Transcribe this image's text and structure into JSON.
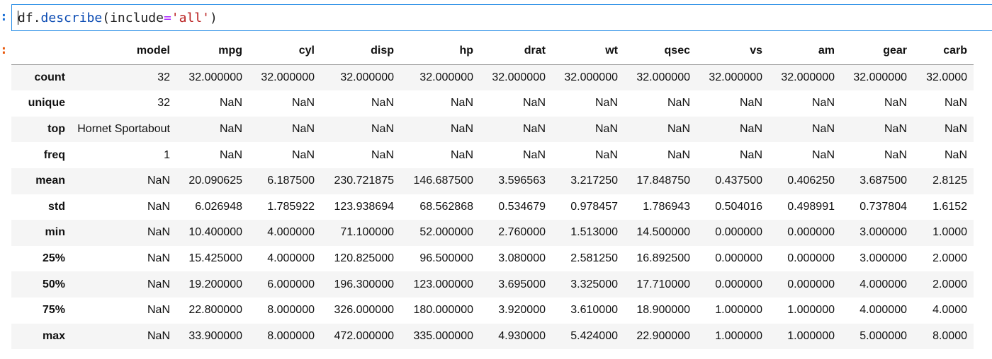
{
  "prompts": {
    "in_marker": ":",
    "out_marker": ":"
  },
  "code": {
    "obj": "df",
    "dot": ".",
    "method": "describe",
    "open": "(",
    "kw": "include",
    "eq": "=",
    "str": "'all'",
    "close": ")"
  },
  "table": {
    "columns": [
      "model",
      "mpg",
      "cyl",
      "disp",
      "hp",
      "drat",
      "wt",
      "qsec",
      "vs",
      "am",
      "gear",
      "carb"
    ],
    "rows": [
      {
        "label": "count",
        "values": [
          "32",
          "32.000000",
          "32.000000",
          "32.000000",
          "32.000000",
          "32.000000",
          "32.000000",
          "32.000000",
          "32.000000",
          "32.000000",
          "32.000000",
          "32.0000"
        ]
      },
      {
        "label": "unique",
        "values": [
          "32",
          "NaN",
          "NaN",
          "NaN",
          "NaN",
          "NaN",
          "NaN",
          "NaN",
          "NaN",
          "NaN",
          "NaN",
          "NaN"
        ]
      },
      {
        "label": "top",
        "values": [
          "Hornet Sportabout",
          "NaN",
          "NaN",
          "NaN",
          "NaN",
          "NaN",
          "NaN",
          "NaN",
          "NaN",
          "NaN",
          "NaN",
          "NaN"
        ]
      },
      {
        "label": "freq",
        "values": [
          "1",
          "NaN",
          "NaN",
          "NaN",
          "NaN",
          "NaN",
          "NaN",
          "NaN",
          "NaN",
          "NaN",
          "NaN",
          "NaN"
        ]
      },
      {
        "label": "mean",
        "values": [
          "NaN",
          "20.090625",
          "6.187500",
          "230.721875",
          "146.687500",
          "3.596563",
          "3.217250",
          "17.848750",
          "0.437500",
          "0.406250",
          "3.687500",
          "2.8125"
        ]
      },
      {
        "label": "std",
        "values": [
          "NaN",
          "6.026948",
          "1.785922",
          "123.938694",
          "68.562868",
          "0.534679",
          "0.978457",
          "1.786943",
          "0.504016",
          "0.498991",
          "0.737804",
          "1.6152"
        ]
      },
      {
        "label": "min",
        "values": [
          "NaN",
          "10.400000",
          "4.000000",
          "71.100000",
          "52.000000",
          "2.760000",
          "1.513000",
          "14.500000",
          "0.000000",
          "0.000000",
          "3.000000",
          "1.0000"
        ]
      },
      {
        "label": "25%",
        "values": [
          "NaN",
          "15.425000",
          "4.000000",
          "120.825000",
          "96.500000",
          "3.080000",
          "2.581250",
          "16.892500",
          "0.000000",
          "0.000000",
          "3.000000",
          "2.0000"
        ]
      },
      {
        "label": "50%",
        "values": [
          "NaN",
          "19.200000",
          "6.000000",
          "196.300000",
          "123.000000",
          "3.695000",
          "3.325000",
          "17.710000",
          "0.000000",
          "0.000000",
          "4.000000",
          "2.0000"
        ]
      },
      {
        "label": "75%",
        "values": [
          "NaN",
          "22.800000",
          "8.000000",
          "326.000000",
          "180.000000",
          "3.920000",
          "3.610000",
          "18.900000",
          "1.000000",
          "1.000000",
          "4.000000",
          "4.0000"
        ]
      },
      {
        "label": "max",
        "values": [
          "NaN",
          "33.900000",
          "8.000000",
          "472.000000",
          "335.000000",
          "4.930000",
          "5.424000",
          "22.900000",
          "1.000000",
          "1.000000",
          "5.000000",
          "8.0000"
        ]
      }
    ]
  }
}
